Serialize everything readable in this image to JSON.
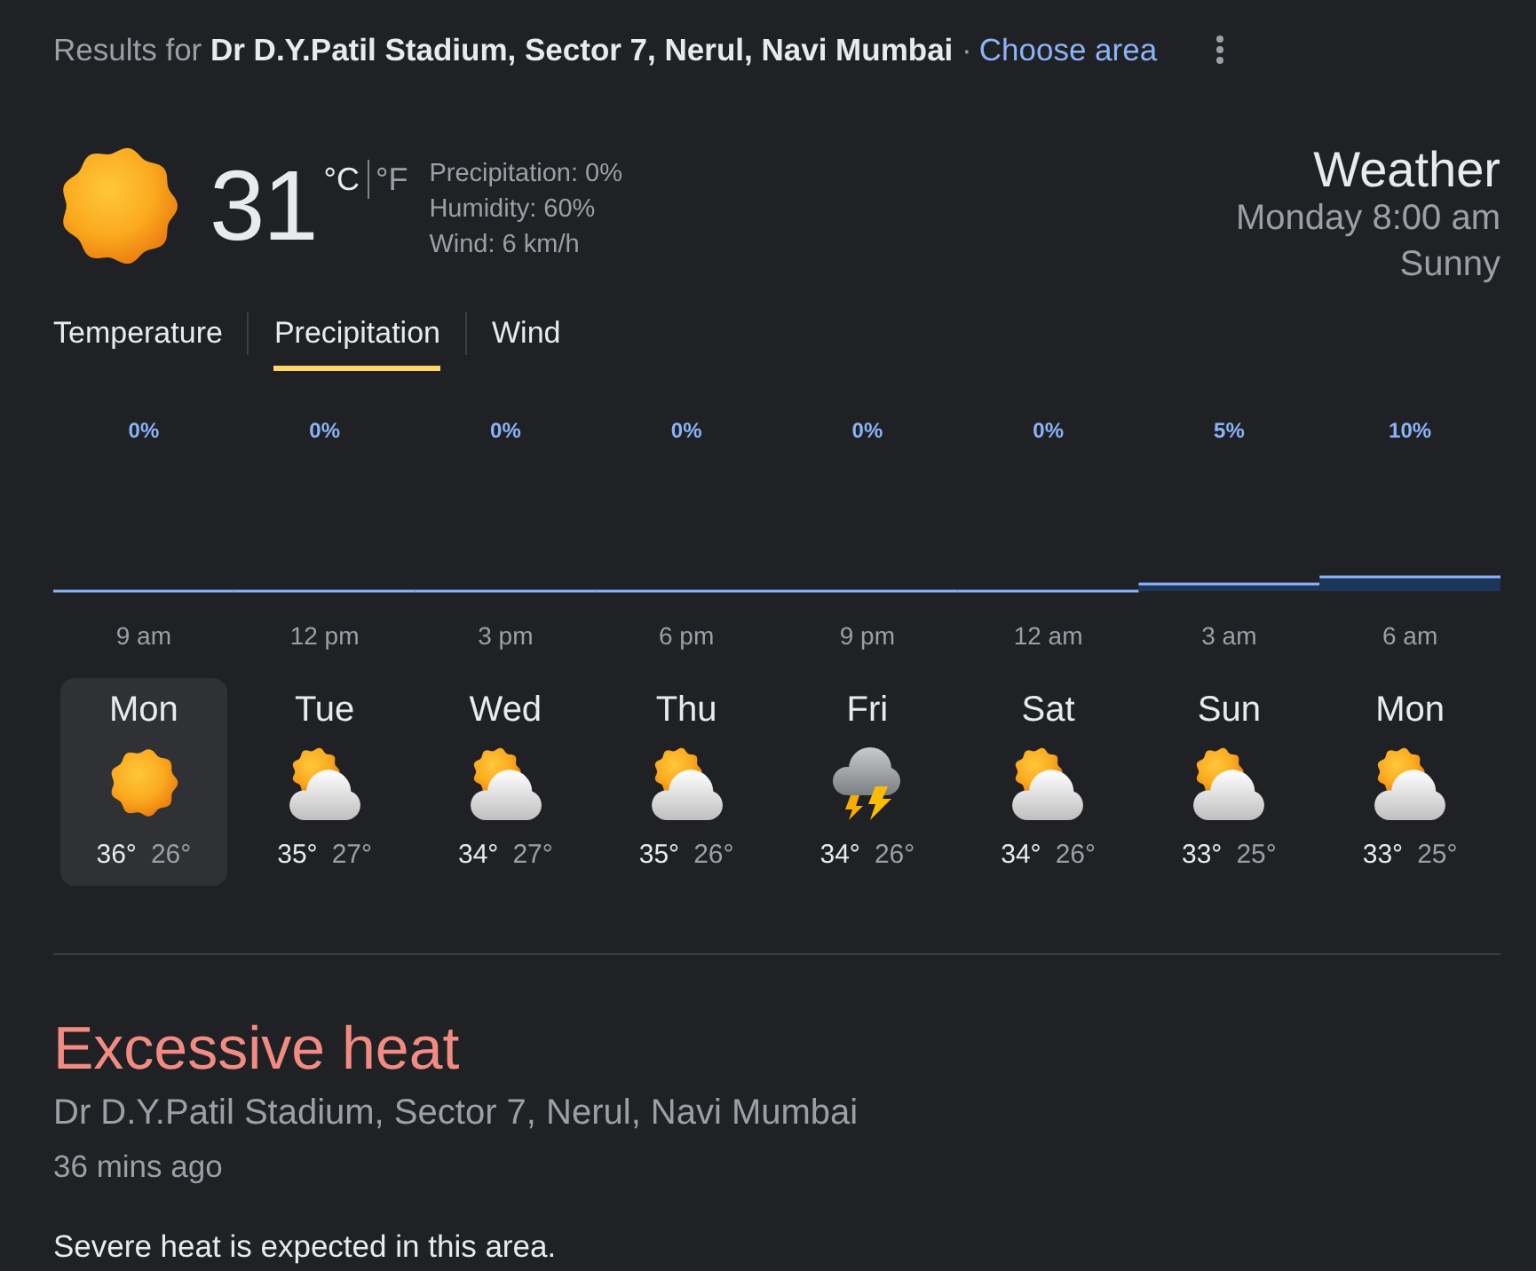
{
  "header": {
    "results_text": "Results for **Dr D.Y.Patil Stadium, Sector 7, Nerul, Navi Mumbai** ·",
    "link": "Choose area"
  },
  "current": {
    "temperature": "31",
    "units": [
      {
        "label": "°C",
        "selected": true
      },
      {
        "label": "°F",
        "selected": false
      }
    ],
    "details": [
      "Precipitation: 0%",
      "Humidity: 60%",
      "Wind: 6 km/h"
    ],
    "title": "Weather",
    "time": "Monday 8:00 am",
    "condition": "Sunny"
  },
  "tabs": [
    {
      "label": "Temperature",
      "selected": false
    },
    {
      "label": "Precipitation",
      "selected": true
    },
    {
      "label": "Wind",
      "selected": false
    }
  ],
  "chart": {
    "chart_data": {
      "type": "bar",
      "categories": [
        "9 am",
        "12 pm",
        "3 pm",
        "6 pm",
        "9 pm",
        "12 am",
        "3 am",
        "6 am"
      ],
      "values": [
        0,
        0,
        0,
        0,
        0,
        0,
        5,
        10
      ],
      "data_labels": true,
      "value_labels": [
        "0%",
        "0%",
        "0%",
        "0%",
        "0%",
        "0%",
        "5%",
        "10%"
      ]
    }
  },
  "days": [
    {
      "day": "Mon",
      "kind": "sunny",
      "high": "36°",
      "low": "26°",
      "selected": true
    },
    {
      "day": "Tue",
      "kind": "partly_cloudy",
      "high": "35°",
      "low": "27°",
      "selected": false
    },
    {
      "day": "Wed",
      "kind": "partly_cloudy",
      "high": "34°",
      "low": "27°",
      "selected": false
    },
    {
      "day": "Thu",
      "kind": "partly_cloudy",
      "high": "35°",
      "low": "26°",
      "selected": false
    },
    {
      "day": "Fri",
      "kind": "thunderstorm",
      "high": "34°",
      "low": "26°",
      "selected": false
    },
    {
      "day": "Sat",
      "kind": "partly_cloudy",
      "high": "34°",
      "low": "26°",
      "selected": false
    },
    {
      "day": "Sun",
      "kind": "partly_cloudy",
      "high": "33°",
      "low": "25°",
      "selected": false
    },
    {
      "day": "Mon",
      "kind": "partly_cloudy",
      "high": "33°",
      "low": "25°",
      "selected": false
    }
  ],
  "alert": {
    "title": "Excessive heat",
    "location": "Dr D.Y.Patil Stadium, Sector 7, Nerul, Navi Mumbai",
    "time": "36 mins ago",
    "description": "Severe heat is expected in this area."
  }
}
